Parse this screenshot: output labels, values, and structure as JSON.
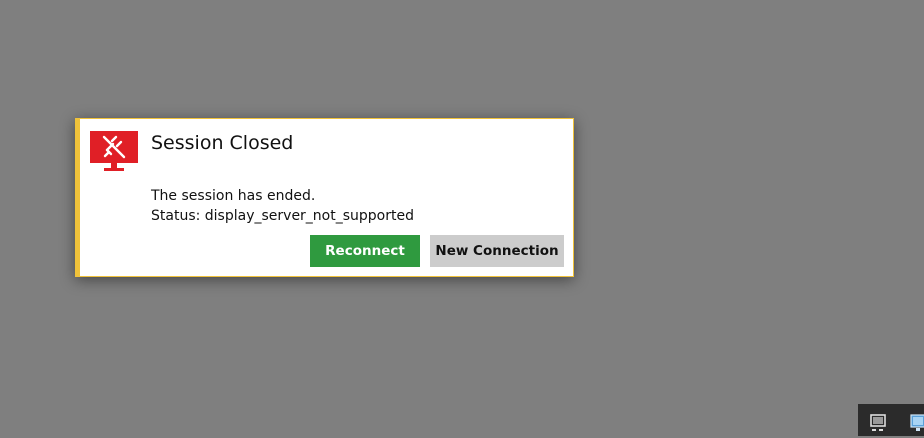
{
  "dialog": {
    "title": "Session Closed",
    "message": "The session has ended.",
    "status_line": "Status: display_server_not_supported",
    "icon": "disconnected-monitor-icon",
    "accent_color": "#f0c23a",
    "icon_color": "#e01f26"
  },
  "buttons": {
    "reconnect_label": "Reconnect",
    "reconnect_color": "#2f9a3f",
    "new_connection_label": "New Connection",
    "new_connection_color": "#cccccc"
  },
  "taskbar": {
    "tray_icons": [
      "monitor-tray-icon",
      "network-tray-icon"
    ]
  }
}
